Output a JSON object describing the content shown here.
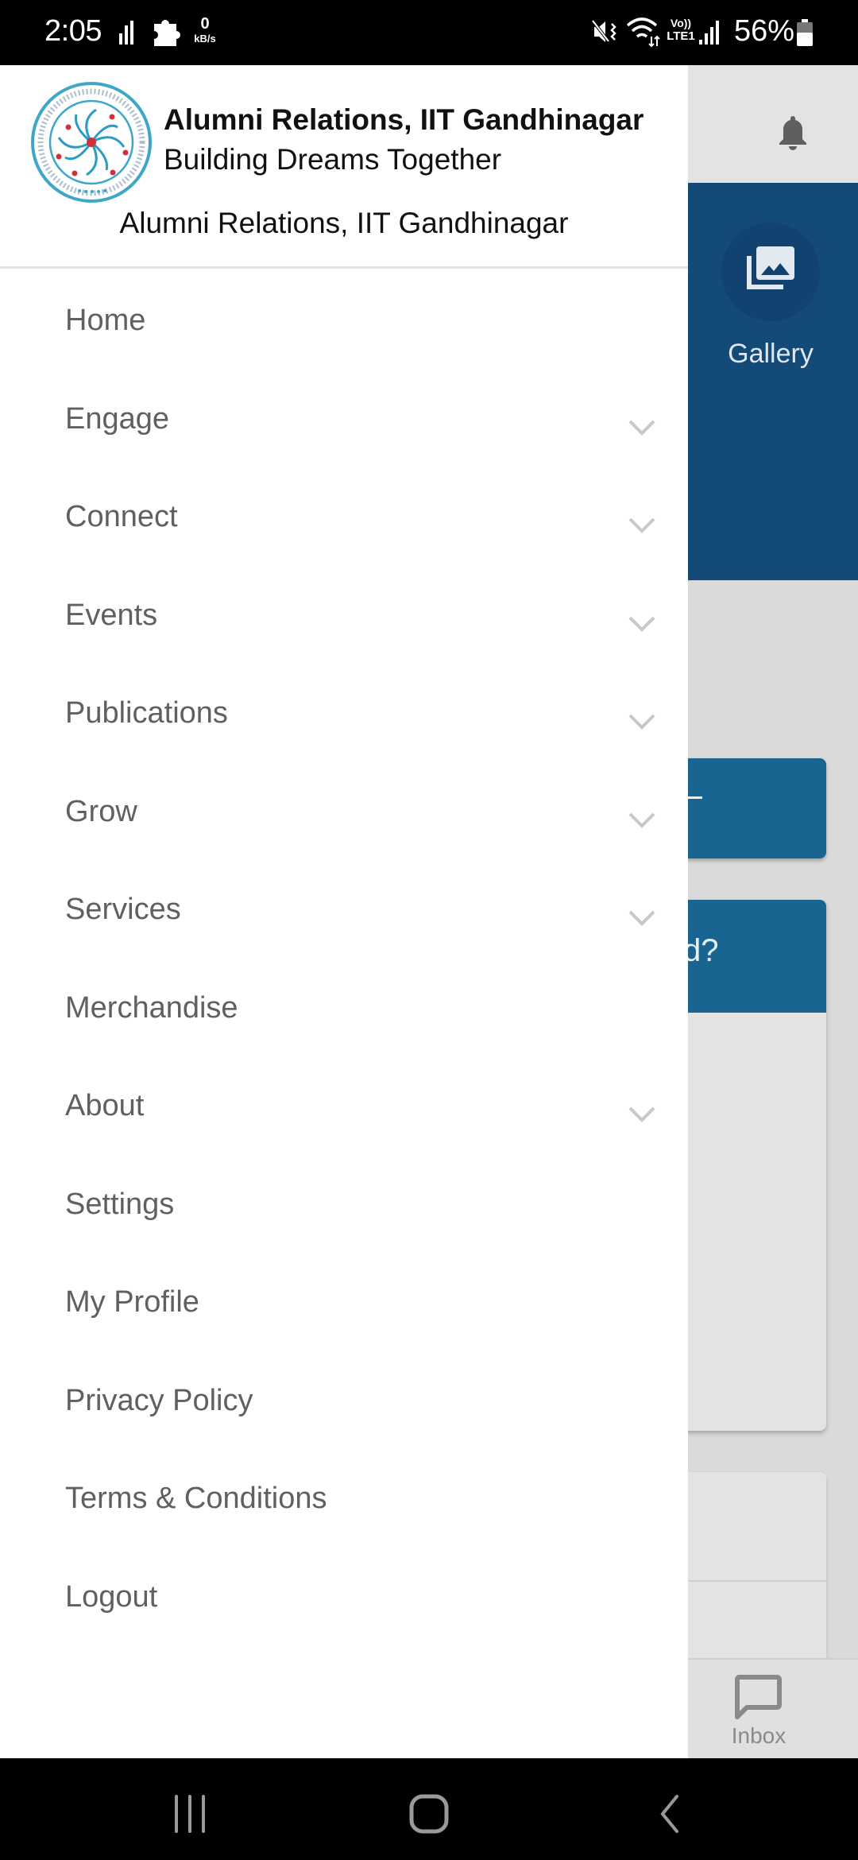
{
  "status_bar": {
    "time": "2:05",
    "data_speed_value": "0",
    "data_speed_unit": "kB/s",
    "network_label_top": "Vo))",
    "network_label_bottom": "LTE1",
    "battery_percent": "56%",
    "icons": [
      "signal-bars-icon",
      "puzzle-icon",
      "mute-vibrate-icon",
      "wifi-icon",
      "cell-signal-icon",
      "battery-icon"
    ]
  },
  "drawer": {
    "header": {
      "title": "Alumni Relations, IIT Gandhinagar",
      "tagline": "Building Dreams Together",
      "subtitle": "Alumni Relations, IIT Gandhinagar",
      "logo_icon": "iit-gandhinagar-logo"
    },
    "menu": [
      {
        "label": "Home",
        "expandable": false
      },
      {
        "label": "Engage",
        "expandable": true
      },
      {
        "label": "Connect",
        "expandable": true
      },
      {
        "label": "Events",
        "expandable": true
      },
      {
        "label": "Publications",
        "expandable": true
      },
      {
        "label": "Grow",
        "expandable": true
      },
      {
        "label": "Services",
        "expandable": true
      },
      {
        "label": "Merchandise",
        "expandable": false
      },
      {
        "label": "About",
        "expandable": true
      },
      {
        "label": "Settings",
        "expandable": false
      },
      {
        "label": "My Profile",
        "expandable": false
      },
      {
        "label": "Privacy Policy",
        "expandable": false
      },
      {
        "label": "Terms & Conditions",
        "expandable": false
      },
      {
        "label": "Logout",
        "expandable": false
      }
    ]
  },
  "background": {
    "gallery_label": "Gallery",
    "card_title_fragment": "d?",
    "inbox_label": "Inbox",
    "colors": {
      "banner": "#134a78",
      "card": "#196592",
      "page": "#dadada"
    }
  },
  "nav_bar": {
    "buttons": [
      "recents-icon",
      "home-icon",
      "back-icon"
    ]
  }
}
